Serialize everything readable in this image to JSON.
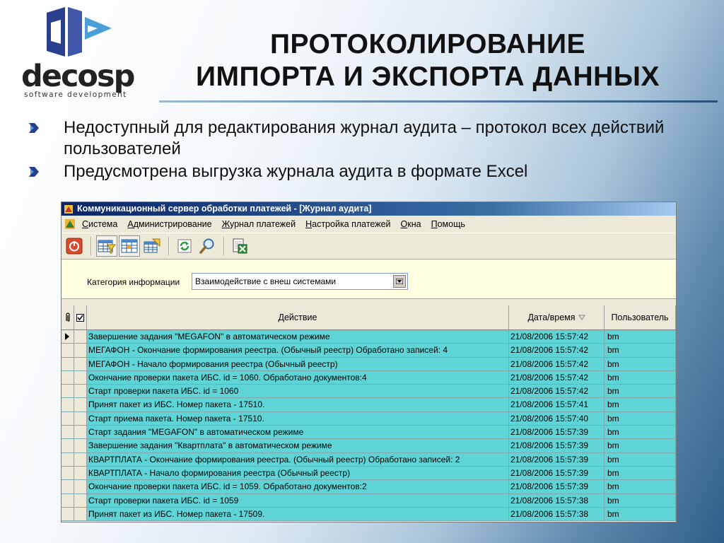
{
  "logo": {
    "wordmark": "decosp",
    "tagline": "software development"
  },
  "title": {
    "line1": "ПРОТОКОЛИРОВАНИЕ",
    "line2": "ИМПОРТА  И ЭКСПОРТА ДАННЫХ"
  },
  "bullets": [
    "Недоступный для редактирования журнал аудита – протокол всех  действий пользователей",
    "Предусмотрена выгрузка журнала аудита в формате Excel"
  ],
  "window": {
    "title": "Коммуникационный сервер обработки платежей - [Журнал аудита]",
    "menu": [
      {
        "u": "С",
        "rest": "истема"
      },
      {
        "u": "А",
        "rest": "дминистрирование"
      },
      {
        "u": "Ж",
        "rest": "урнал платежей"
      },
      {
        "u": "Н",
        "rest": "астройка платежей"
      },
      {
        "u": "О",
        "rest": "кна"
      },
      {
        "u": "П",
        "rest": "омощь"
      }
    ],
    "filter": {
      "label": "Категория информации",
      "value": "Взаимодействие с внеш системами"
    },
    "columns": {
      "action": "Действие",
      "datetime": "Дата/время",
      "user": "Пользователь"
    },
    "rows": [
      {
        "action": "Завершение задания \"MEGAFON\" в автоматическом режиме",
        "datetime": "21/08/2006 15:57:42",
        "user": "bm"
      },
      {
        "action": "МЕГАФОН - Окончание формирования реестра. (Обычный реестр) Обработано записей: 4",
        "datetime": "21/08/2006 15:57:42",
        "user": "bm"
      },
      {
        "action": "МЕГАФОН - Начало формирования реестра (Обычный реестр)",
        "datetime": "21/08/2006 15:57:42",
        "user": "bm"
      },
      {
        "action": "Окончание проверки пакета ИБС. id = 1060. Обработано документов:4",
        "datetime": "21/08/2006 15:57:42",
        "user": "bm"
      },
      {
        "action": "Старт проверки пакета ИБС. id = 1060",
        "datetime": "21/08/2006 15:57:42",
        "user": "bm"
      },
      {
        "action": "Принят пакет из ИБС. Номер пакета - 17510.",
        "datetime": "21/08/2006 15:57:41",
        "user": "bm"
      },
      {
        "action": "Старт приема пакета. Номер пакета - 17510.",
        "datetime": "21/08/2006 15:57:40",
        "user": "bm"
      },
      {
        "action": "Старт задания \"MEGAFON\" в автоматическом режиме",
        "datetime": "21/08/2006 15:57:39",
        "user": "bm"
      },
      {
        "action": "Завершение задания \"Квартплата\" в автоматическом режиме",
        "datetime": "21/08/2006 15:57:39",
        "user": "bm"
      },
      {
        "action": "КВАРТПЛАТА - Окончание формирования реестра. (Обычный реестр) Обработано записей: 2",
        "datetime": "21/08/2006 15:57:39",
        "user": "bm"
      },
      {
        "action": "КВАРТПЛАТА - Начало формирования реестра (Обычный реестр)",
        "datetime": "21/08/2006 15:57:39",
        "user": "bm"
      },
      {
        "action": "Окончание проверки пакета ИБС. id = 1059. Обработано документов:2",
        "datetime": "21/08/2006 15:57:39",
        "user": "bm"
      },
      {
        "action": "Старт проверки пакета ИБС. id = 1059",
        "datetime": "21/08/2006 15:57:38",
        "user": "bm"
      },
      {
        "action": "Принят пакет из ИБС. Номер пакета - 17509.",
        "datetime": "21/08/2006 15:57:38",
        "user": "bm"
      }
    ]
  },
  "colors": {
    "grid_row": "#5fd4d6",
    "titlebar": "#0a246a",
    "filter_bg": "#ffffe1",
    "accent": "#27517a"
  },
  "icons": [
    "power-icon",
    "filter-table-icon",
    "table-icon",
    "refresh-table-icon",
    "reload-icon",
    "search-icon",
    "excel-export-icon"
  ]
}
